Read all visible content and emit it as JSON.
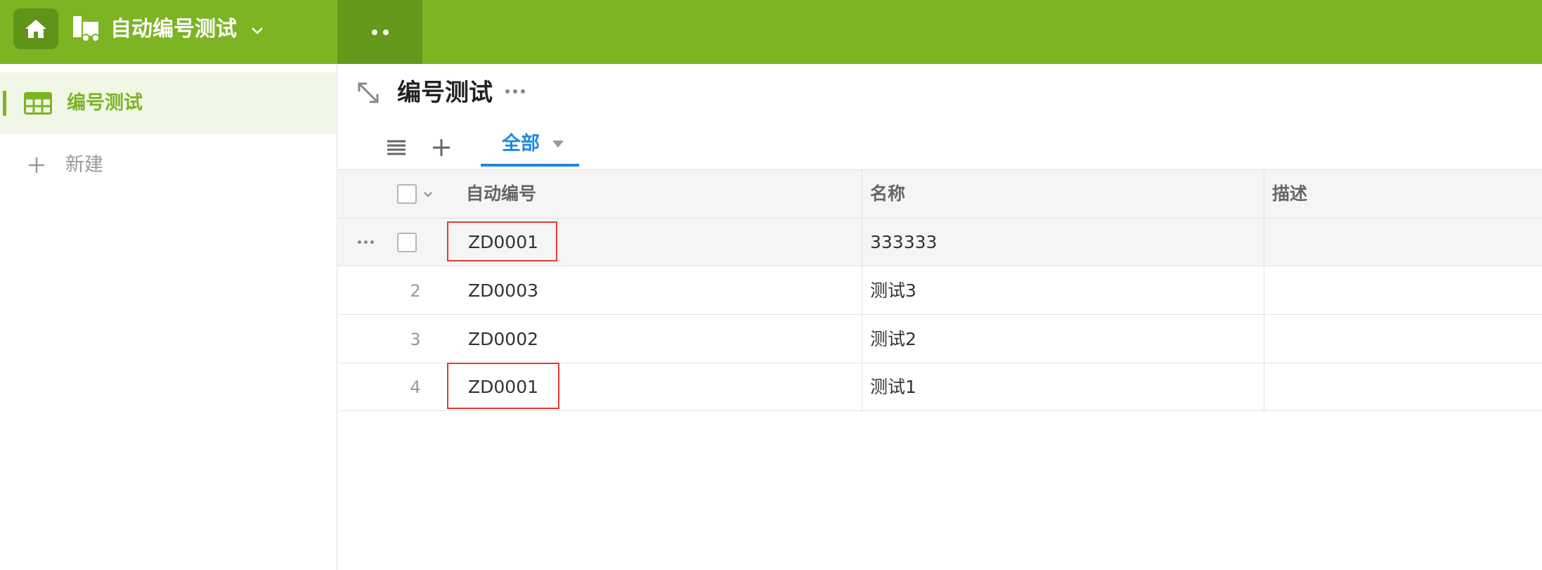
{
  "topbar": {
    "app_title": "自动编号测试",
    "home_icon": "home-icon",
    "app_icon": "app-icon",
    "chevron_icon": "chevron-down-icon",
    "colors": {
      "bar": "#7cb424",
      "home_bg": "#5f9418",
      "dots_tab_bg": "#64991c"
    }
  },
  "sidebar": {
    "items": [
      {
        "label": "编号测试",
        "icon": "table-grid-icon",
        "active": true
      }
    ],
    "new_label": "新建",
    "accent": "#7cb424"
  },
  "main": {
    "title": "编号测试",
    "tabs": [
      {
        "label": "全部",
        "active": true
      }
    ],
    "tab_accent": "#1e88e5"
  },
  "table": {
    "columns": [
      "自动编号",
      "名称",
      "描述"
    ],
    "rows": [
      {
        "num": "",
        "code": "ZD0001",
        "name": "333333",
        "desc": "",
        "highlighted": true
      },
      {
        "num": "2",
        "code": "ZD0003",
        "name": "测试3",
        "desc": "",
        "highlighted": false
      },
      {
        "num": "3",
        "code": "ZD0002",
        "name": "测试2",
        "desc": "",
        "highlighted": false
      },
      {
        "num": "4",
        "code": "ZD0001",
        "name": "测试1",
        "desc": "",
        "highlighted": true
      }
    ],
    "highlight_color": "#e53935"
  }
}
